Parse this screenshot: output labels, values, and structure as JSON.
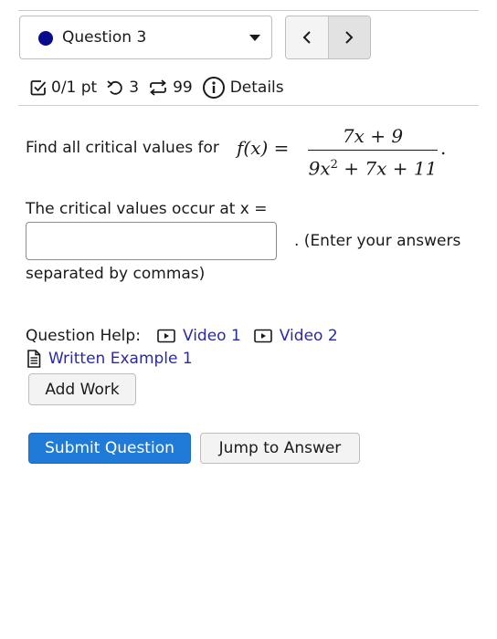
{
  "question_selector": {
    "label": "Question 3",
    "status_color": "#0a0a8f",
    "icon": "chevron-down-icon"
  },
  "nav": {
    "prev_icon": "chevron-left-icon",
    "next_icon": "chevron-right-icon"
  },
  "meta": {
    "score": "0/1 pt",
    "retries": "3",
    "attempts": "99",
    "details": "Details"
  },
  "question": {
    "prompt": "Find all critical values for",
    "function_lhs": "f(x) =",
    "numerator": "7x + 9",
    "denominator_parts": [
      "9x",
      "2",
      " + 7x + 11"
    ],
    "period": ".",
    "answer_prompt": "The critical values occur at x =",
    "answer_value": "",
    "answer_note": ". (Enter your answers",
    "answer_note_cont": "separated by commas)"
  },
  "help": {
    "label": "Question Help:",
    "video1": "Video 1",
    "video2": "Video 2",
    "example": "Written Example 1",
    "link_color": "#2a2aa8"
  },
  "buttons": {
    "add_work": "Add Work",
    "submit": "Submit Question",
    "jump": "Jump to Answer",
    "submit_color": "#1f7ad8"
  }
}
